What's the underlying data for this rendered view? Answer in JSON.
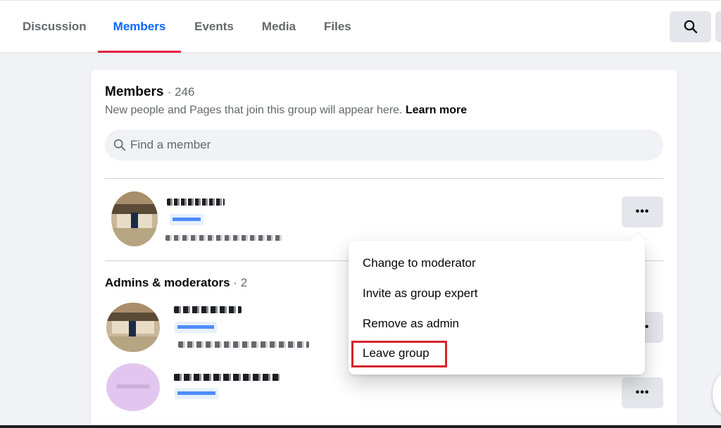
{
  "tabs": [
    {
      "label": "Discussion"
    },
    {
      "label": "Members",
      "active": true
    },
    {
      "label": "Events"
    },
    {
      "label": "Media"
    },
    {
      "label": "Files"
    }
  ],
  "header": {
    "search_icon": "search-icon"
  },
  "members_card": {
    "title": "Members",
    "count": "· 246",
    "subtitle": "New people and Pages that join this group will appear here.",
    "learn_more": "Learn more",
    "search_placeholder": "Find a member"
  },
  "admins_section": {
    "title": "Admins & moderators",
    "count": "· 2"
  },
  "row_menu": {
    "items": [
      {
        "label": "Change to moderator"
      },
      {
        "label": "Invite as group expert"
      },
      {
        "label": "Remove as admin"
      },
      {
        "label": "Leave group",
        "highlighted": true
      }
    ]
  },
  "colors": {
    "accent": "#0866ff",
    "tab_underline": "#e41e3f",
    "highlight_box": "#d6252b"
  }
}
